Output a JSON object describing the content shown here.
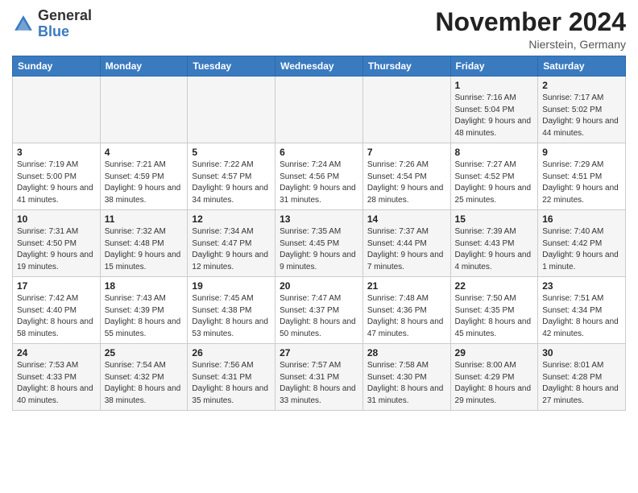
{
  "header": {
    "logo_general": "General",
    "logo_blue": "Blue",
    "month_title": "November 2024",
    "location": "Nierstein, Germany"
  },
  "days_of_week": [
    "Sunday",
    "Monday",
    "Tuesday",
    "Wednesday",
    "Thursday",
    "Friday",
    "Saturday"
  ],
  "weeks": [
    [
      {
        "day": "",
        "detail": ""
      },
      {
        "day": "",
        "detail": ""
      },
      {
        "day": "",
        "detail": ""
      },
      {
        "day": "",
        "detail": ""
      },
      {
        "day": "",
        "detail": ""
      },
      {
        "day": "1",
        "detail": "Sunrise: 7:16 AM\nSunset: 5:04 PM\nDaylight: 9 hours and 48 minutes."
      },
      {
        "day": "2",
        "detail": "Sunrise: 7:17 AM\nSunset: 5:02 PM\nDaylight: 9 hours and 44 minutes."
      }
    ],
    [
      {
        "day": "3",
        "detail": "Sunrise: 7:19 AM\nSunset: 5:00 PM\nDaylight: 9 hours and 41 minutes."
      },
      {
        "day": "4",
        "detail": "Sunrise: 7:21 AM\nSunset: 4:59 PM\nDaylight: 9 hours and 38 minutes."
      },
      {
        "day": "5",
        "detail": "Sunrise: 7:22 AM\nSunset: 4:57 PM\nDaylight: 9 hours and 34 minutes."
      },
      {
        "day": "6",
        "detail": "Sunrise: 7:24 AM\nSunset: 4:56 PM\nDaylight: 9 hours and 31 minutes."
      },
      {
        "day": "7",
        "detail": "Sunrise: 7:26 AM\nSunset: 4:54 PM\nDaylight: 9 hours and 28 minutes."
      },
      {
        "day": "8",
        "detail": "Sunrise: 7:27 AM\nSunset: 4:52 PM\nDaylight: 9 hours and 25 minutes."
      },
      {
        "day": "9",
        "detail": "Sunrise: 7:29 AM\nSunset: 4:51 PM\nDaylight: 9 hours and 22 minutes."
      }
    ],
    [
      {
        "day": "10",
        "detail": "Sunrise: 7:31 AM\nSunset: 4:50 PM\nDaylight: 9 hours and 19 minutes."
      },
      {
        "day": "11",
        "detail": "Sunrise: 7:32 AM\nSunset: 4:48 PM\nDaylight: 9 hours and 15 minutes."
      },
      {
        "day": "12",
        "detail": "Sunrise: 7:34 AM\nSunset: 4:47 PM\nDaylight: 9 hours and 12 minutes."
      },
      {
        "day": "13",
        "detail": "Sunrise: 7:35 AM\nSunset: 4:45 PM\nDaylight: 9 hours and 9 minutes."
      },
      {
        "day": "14",
        "detail": "Sunrise: 7:37 AM\nSunset: 4:44 PM\nDaylight: 9 hours and 7 minutes."
      },
      {
        "day": "15",
        "detail": "Sunrise: 7:39 AM\nSunset: 4:43 PM\nDaylight: 9 hours and 4 minutes."
      },
      {
        "day": "16",
        "detail": "Sunrise: 7:40 AM\nSunset: 4:42 PM\nDaylight: 9 hours and 1 minute."
      }
    ],
    [
      {
        "day": "17",
        "detail": "Sunrise: 7:42 AM\nSunset: 4:40 PM\nDaylight: 8 hours and 58 minutes."
      },
      {
        "day": "18",
        "detail": "Sunrise: 7:43 AM\nSunset: 4:39 PM\nDaylight: 8 hours and 55 minutes."
      },
      {
        "day": "19",
        "detail": "Sunrise: 7:45 AM\nSunset: 4:38 PM\nDaylight: 8 hours and 53 minutes."
      },
      {
        "day": "20",
        "detail": "Sunrise: 7:47 AM\nSunset: 4:37 PM\nDaylight: 8 hours and 50 minutes."
      },
      {
        "day": "21",
        "detail": "Sunrise: 7:48 AM\nSunset: 4:36 PM\nDaylight: 8 hours and 47 minutes."
      },
      {
        "day": "22",
        "detail": "Sunrise: 7:50 AM\nSunset: 4:35 PM\nDaylight: 8 hours and 45 minutes."
      },
      {
        "day": "23",
        "detail": "Sunrise: 7:51 AM\nSunset: 4:34 PM\nDaylight: 8 hours and 42 minutes."
      }
    ],
    [
      {
        "day": "24",
        "detail": "Sunrise: 7:53 AM\nSunset: 4:33 PM\nDaylight: 8 hours and 40 minutes."
      },
      {
        "day": "25",
        "detail": "Sunrise: 7:54 AM\nSunset: 4:32 PM\nDaylight: 8 hours and 38 minutes."
      },
      {
        "day": "26",
        "detail": "Sunrise: 7:56 AM\nSunset: 4:31 PM\nDaylight: 8 hours and 35 minutes."
      },
      {
        "day": "27",
        "detail": "Sunrise: 7:57 AM\nSunset: 4:31 PM\nDaylight: 8 hours and 33 minutes."
      },
      {
        "day": "28",
        "detail": "Sunrise: 7:58 AM\nSunset: 4:30 PM\nDaylight: 8 hours and 31 minutes."
      },
      {
        "day": "29",
        "detail": "Sunrise: 8:00 AM\nSunset: 4:29 PM\nDaylight: 8 hours and 29 minutes."
      },
      {
        "day": "30",
        "detail": "Sunrise: 8:01 AM\nSunset: 4:28 PM\nDaylight: 8 hours and 27 minutes."
      }
    ]
  ]
}
